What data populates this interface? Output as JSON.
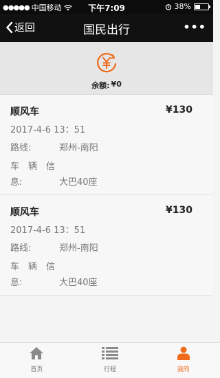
{
  "status_bar": {
    "signal_dots": "●●●●●",
    "carrier": "中国移动",
    "time": "下午7:09",
    "battery_percent": "38%",
    "battery_level": 0.38
  },
  "navbar": {
    "back_label": "返回",
    "title": "国民出行",
    "more_label": "•••"
  },
  "balance": {
    "label": "余额:",
    "value": "¥0",
    "accent_color": "#f06a1a"
  },
  "trips": [
    {
      "name": "顺风车",
      "price": "¥130",
      "datetime": "2017-4-6 13：51",
      "route_label": "路线:",
      "route_value": "郑州-南阳",
      "vehicle_label_line1": "车　辆　信",
      "vehicle_label_line2": "息:",
      "vehicle_value": "大巴40座"
    },
    {
      "name": "顺风车",
      "price": "¥130",
      "datetime": "2017-4-6 13：51",
      "route_label": "路线:",
      "route_value": "郑州-南阳",
      "vehicle_label_line1": "车　辆　信",
      "vehicle_label_line2": "息:",
      "vehicle_value": "大巴40座"
    }
  ],
  "tabbar": {
    "items": [
      {
        "label": "首页",
        "icon": "home-icon"
      },
      {
        "label": "行程",
        "icon": "list-icon"
      },
      {
        "label": "我的",
        "icon": "user-icon",
        "active": true
      }
    ]
  }
}
